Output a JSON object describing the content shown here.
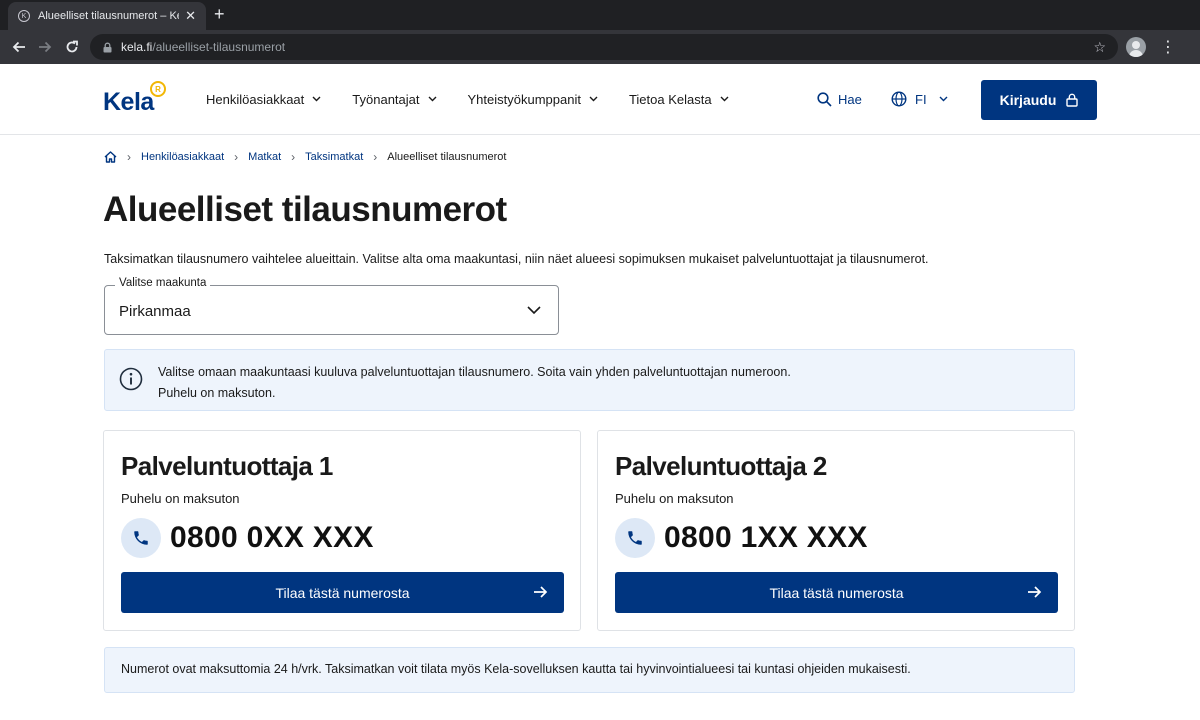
{
  "browser": {
    "tab_title": "Alueelliset tilausnumerot – Kela",
    "tab_close": "✕",
    "new_tab": "+",
    "url_host": "kela.fi",
    "url_path": "/alueelliset-tilausnumerot"
  },
  "header": {
    "logo_text": "Kela",
    "logo_badge": "R",
    "nav_items": [
      "Henkilöasiakkaat",
      "Työnantajat",
      "Yhteistyökumppanit",
      "Tietoa Kelasta"
    ],
    "search_label": "Hae",
    "language": "FI",
    "login_label": "Kirjaudu"
  },
  "breadcrumb": {
    "items": [
      "Henkilöasiakkaat",
      "Matkat",
      "Taksimatkat"
    ],
    "current": "Alueelliset tilausnumerot"
  },
  "page": {
    "title": "Alueelliset tilausnumerot",
    "intro": "Taksimatkan tilausnumero vaihtelee alueittain. Valitse alta oma maakuntasi, niin näet alueesi sopimuksen mukaiset palveluntuottajat ja tilausnumerot."
  },
  "region_select": {
    "label": "Valitse maakunta",
    "value": "Pirkanmaa"
  },
  "info": {
    "line1": "Valitse omaan maakuntaasi kuuluva palveluntuottajan tilausnumero. Soita vain yhden palveluntuottajan numeroon.",
    "line2": "Puhelu on maksuton."
  },
  "providers": [
    {
      "name": "Palveluntuottaja 1",
      "note": "Puhelu on maksuton",
      "phone": "0800 0XX XXX",
      "button_label": "Tilaa tästä numerosta"
    },
    {
      "name": "Palveluntuottaja 2",
      "note": "Puhelu on maksuton",
      "phone": "0800 1XX XXX",
      "button_label": "Tilaa tästä numerosta"
    }
  ],
  "footer_note": "Numerot ovat maksuttomia 24 h/vrk. Taksimatkan voit tilata myös Kela-sovelluksen kautta tai hyvinvointialueesi tai kuntasi ohjeiden mukaisesti.",
  "colors": {
    "brand": "#003580",
    "info_bg": "#eef4fc",
    "logo_accent": "#f2b705"
  },
  "icons": [
    "kela-favicon-icon",
    "back-arrow-icon",
    "forward-arrow-icon",
    "reload-icon",
    "lock-icon",
    "star-icon",
    "profile-icon",
    "kebab-menu-icon",
    "chevron-down-icon",
    "search-icon",
    "globe-icon",
    "padlock-icon",
    "home-icon",
    "info-icon",
    "phone-icon",
    "arrow-right-icon"
  ]
}
